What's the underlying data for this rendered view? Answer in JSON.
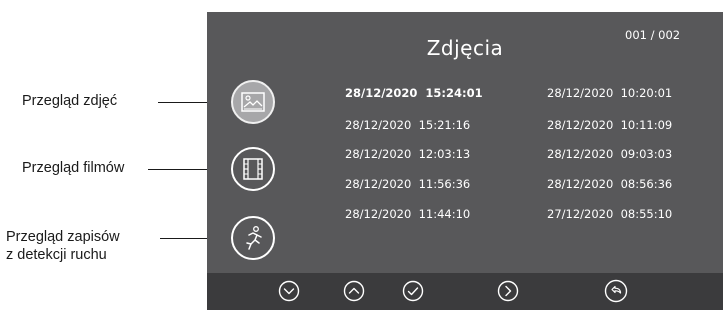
{
  "screen": {
    "title": "Zdjęcia",
    "page_indicator": "001 / 002",
    "accent_color": "#58585a",
    "bar_color": "#3b3b3d"
  },
  "sidebar": {
    "items": [
      {
        "name": "photos",
        "icon": "photo-icon",
        "active": true
      },
      {
        "name": "videos",
        "icon": "film-icon",
        "active": false
      },
      {
        "name": "motion",
        "icon": "running-man-icon",
        "active": false
      }
    ]
  },
  "list": {
    "left": [
      "28/12/2020  15:24:01",
      "28/12/2020  15:21:16",
      "28/12/2020  12:03:13",
      "28/12/2020  11:56:36",
      "28/12/2020  11:44:10"
    ],
    "right": [
      "28/12/2020  10:20:01",
      "28/12/2020  10:11:09",
      "28/12/2020  09:03:03",
      "28/12/2020  08:56:36",
      "27/12/2020  08:55:10"
    ],
    "selected": "28/12/2020  15:24:01"
  },
  "bottom_bar": {
    "buttons": [
      {
        "name": "down",
        "icon": "chevron-down-icon"
      },
      {
        "name": "up",
        "icon": "chevron-up-icon"
      },
      {
        "name": "confirm",
        "icon": "checkmark-icon"
      },
      {
        "name": "next",
        "icon": "chevron-right-icon"
      },
      {
        "name": "back",
        "icon": "return-icon"
      }
    ]
  },
  "annotations": {
    "photos": "Przegląd zdjęć",
    "videos": "Przegląd filmów",
    "motion_line1": "Przegląd zapisów",
    "motion_line2": "z detekcji ruchu"
  }
}
